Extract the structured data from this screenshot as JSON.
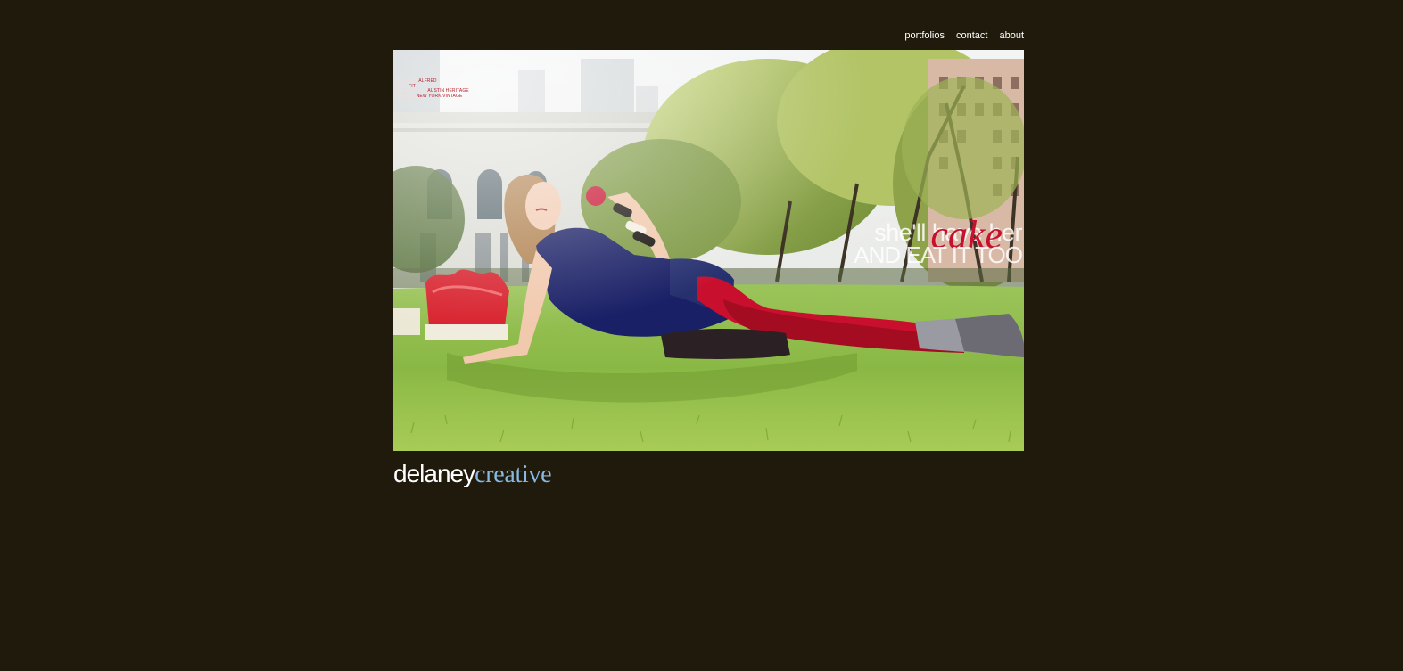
{
  "nav": {
    "items": [
      {
        "label": "portfolios"
      },
      {
        "label": "contact"
      },
      {
        "label": "about"
      }
    ]
  },
  "hero": {
    "credits": [
      {
        "label": "blue dress",
        "value": "ALFRED"
      },
      {
        "label": "tights",
        "value": "FIT"
      },
      {
        "label": "bag and shoes",
        "value": "AUSTIN HERITAGE"
      },
      {
        "label": "bracelets",
        "value": "NEW YORK VINTAGE"
      }
    ],
    "tagline_line1": "she'll have her",
    "tagline_word": "cake",
    "tagline_line2": "AND EAT IT TOO"
  },
  "logo": {
    "primary": "delaney",
    "secondary": "creative"
  },
  "colors": {
    "background": "#1f1a0c",
    "logo_accent": "#88b9e1",
    "tagline_accent": "#c8102e"
  }
}
